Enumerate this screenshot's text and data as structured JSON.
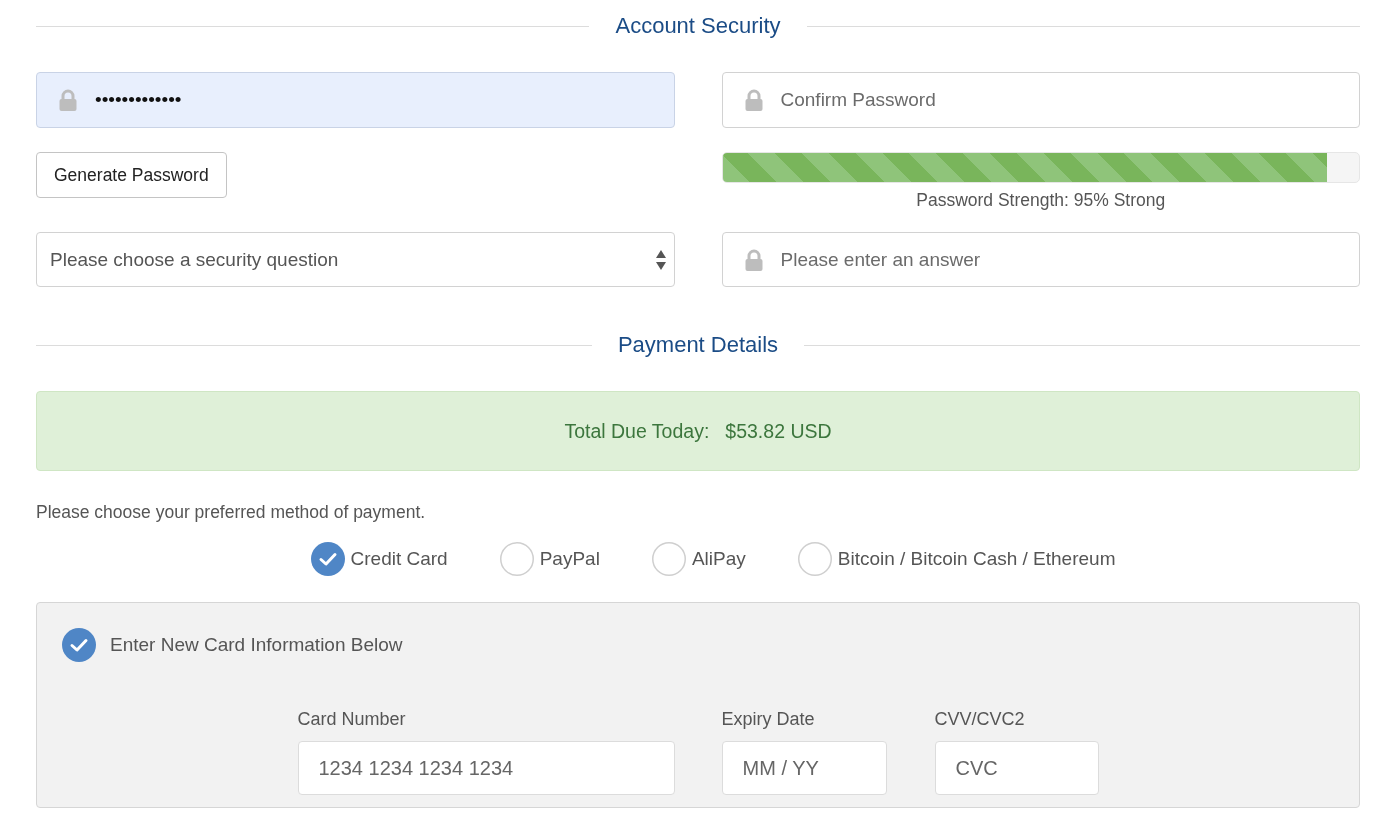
{
  "account_security": {
    "title": "Account Security",
    "password": {
      "value": "•••••••••••••",
      "autofilled": true
    },
    "confirm_password": {
      "placeholder": "Confirm Password"
    },
    "generate_button": "Generate Password",
    "strength": {
      "level": 0.95,
      "label": "Password Strength: 95% Strong"
    },
    "security_question": {
      "value": "Please choose a security question"
    },
    "answer": {
      "placeholder": "Please enter an answer"
    }
  },
  "payment_details": {
    "title": "Payment Details",
    "total": {
      "label": "Total Due Today:",
      "amount": "$53.82 USD"
    },
    "prompt": "Please choose your preferred method of payment.",
    "methods": [
      {
        "label": "Credit Card",
        "selected": true
      },
      {
        "label": "PayPal",
        "selected": false
      },
      {
        "label": "AliPay",
        "selected": false
      },
      {
        "label": "Bitcoin / Bitcoin Cash / Ethereum",
        "selected": false
      }
    ],
    "card_panel": {
      "new_card": {
        "label": "Enter New Card Information Below",
        "checked": true
      },
      "fields": [
        {
          "label": "Card Number",
          "placeholder": "1234 1234 1234 1234"
        },
        {
          "label": "Expiry Date",
          "placeholder": "MM / YY"
        },
        {
          "label": "CVV/CVC2",
          "placeholder": "CVC"
        }
      ]
    }
  }
}
